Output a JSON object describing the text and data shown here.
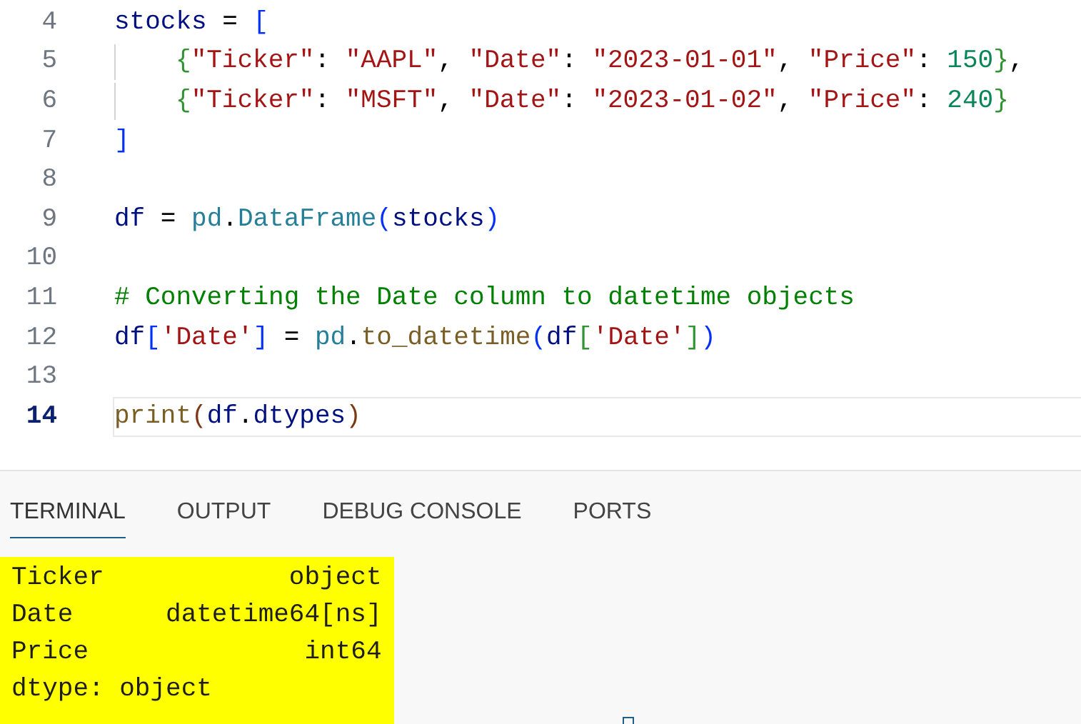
{
  "editor": {
    "lines": [
      {
        "number": "4",
        "current": false,
        "tokens": [
          {
            "kind": "var",
            "text": "stocks"
          },
          {
            "kind": "op",
            "text": " = "
          },
          {
            "kind": "bracket1",
            "text": "["
          }
        ]
      },
      {
        "number": "5",
        "current": false,
        "indented": true,
        "tokens": [
          {
            "kind": "bracket2",
            "text": "{"
          },
          {
            "kind": "string",
            "text": "\"Ticker\""
          },
          {
            "kind": "op",
            "text": ": "
          },
          {
            "kind": "string",
            "text": "\"AAPL\""
          },
          {
            "kind": "op",
            "text": ", "
          },
          {
            "kind": "string",
            "text": "\"Date\""
          },
          {
            "kind": "op",
            "text": ": "
          },
          {
            "kind": "string",
            "text": "\"2023-01-01\""
          },
          {
            "kind": "op",
            "text": ", "
          },
          {
            "kind": "string",
            "text": "\"Price\""
          },
          {
            "kind": "op",
            "text": ": "
          },
          {
            "kind": "number",
            "text": "150"
          },
          {
            "kind": "bracket2",
            "text": "}"
          },
          {
            "kind": "op",
            "text": ","
          }
        ]
      },
      {
        "number": "6",
        "current": false,
        "indented": true,
        "tokens": [
          {
            "kind": "bracket2",
            "text": "{"
          },
          {
            "kind": "string",
            "text": "\"Ticker\""
          },
          {
            "kind": "op",
            "text": ": "
          },
          {
            "kind": "string",
            "text": "\"MSFT\""
          },
          {
            "kind": "op",
            "text": ", "
          },
          {
            "kind": "string",
            "text": "\"Date\""
          },
          {
            "kind": "op",
            "text": ": "
          },
          {
            "kind": "string",
            "text": "\"2023-01-02\""
          },
          {
            "kind": "op",
            "text": ", "
          },
          {
            "kind": "string",
            "text": "\"Price\""
          },
          {
            "kind": "op",
            "text": ": "
          },
          {
            "kind": "number",
            "text": "240"
          },
          {
            "kind": "bracket2",
            "text": "}"
          }
        ]
      },
      {
        "number": "7",
        "current": false,
        "tokens": [
          {
            "kind": "bracket1",
            "text": "]"
          }
        ]
      },
      {
        "number": "8",
        "current": false
      },
      {
        "number": "9",
        "current": false,
        "tokens": [
          {
            "kind": "var",
            "text": "df"
          },
          {
            "kind": "op",
            "text": " = "
          },
          {
            "kind": "module",
            "text": "pd"
          },
          {
            "kind": "op",
            "text": "."
          },
          {
            "kind": "module",
            "text": "DataFrame"
          },
          {
            "kind": "bracket1",
            "text": "("
          },
          {
            "kind": "var",
            "text": "stocks"
          },
          {
            "kind": "bracket1",
            "text": ")"
          }
        ]
      },
      {
        "number": "10",
        "current": false
      },
      {
        "number": "11",
        "current": false,
        "tokens": [
          {
            "kind": "comment",
            "text": "# Converting the Date column to datetime objects"
          }
        ]
      },
      {
        "number": "12",
        "current": false,
        "tokens": [
          {
            "kind": "var",
            "text": "df"
          },
          {
            "kind": "bracket1",
            "text": "["
          },
          {
            "kind": "string",
            "text": "'Date'"
          },
          {
            "kind": "bracket1",
            "text": "]"
          },
          {
            "kind": "op",
            "text": " = "
          },
          {
            "kind": "module",
            "text": "pd"
          },
          {
            "kind": "op",
            "text": "."
          },
          {
            "kind": "func",
            "text": "to_datetime"
          },
          {
            "kind": "bracket1",
            "text": "("
          },
          {
            "kind": "var",
            "text": "df"
          },
          {
            "kind": "bracket2",
            "text": "["
          },
          {
            "kind": "string",
            "text": "'Date'"
          },
          {
            "kind": "bracket2",
            "text": "]"
          },
          {
            "kind": "bracket1",
            "text": ")"
          }
        ]
      },
      {
        "number": "13",
        "current": false
      },
      {
        "number": "14",
        "current": true,
        "tokens": [
          {
            "kind": "func",
            "text": "print"
          },
          {
            "kind": "bracket3",
            "text": "("
          },
          {
            "kind": "var",
            "text": "df"
          },
          {
            "kind": "op",
            "text": "."
          },
          {
            "kind": "var",
            "text": "dtypes"
          },
          {
            "kind": "bracket3",
            "text": ")"
          }
        ]
      }
    ]
  },
  "panel": {
    "tabs": [
      {
        "label": "TERMINAL",
        "selected": true
      },
      {
        "label": "OUTPUT",
        "selected": false
      },
      {
        "label": "DEBUG CONSOLE",
        "selected": false
      },
      {
        "label": "PORTS",
        "selected": false
      }
    ],
    "output": {
      "highlighted": true,
      "lines": [
        "Ticker            object",
        "Date      datetime64[ns]",
        "Price              int64",
        "dtype: object"
      ]
    }
  }
}
